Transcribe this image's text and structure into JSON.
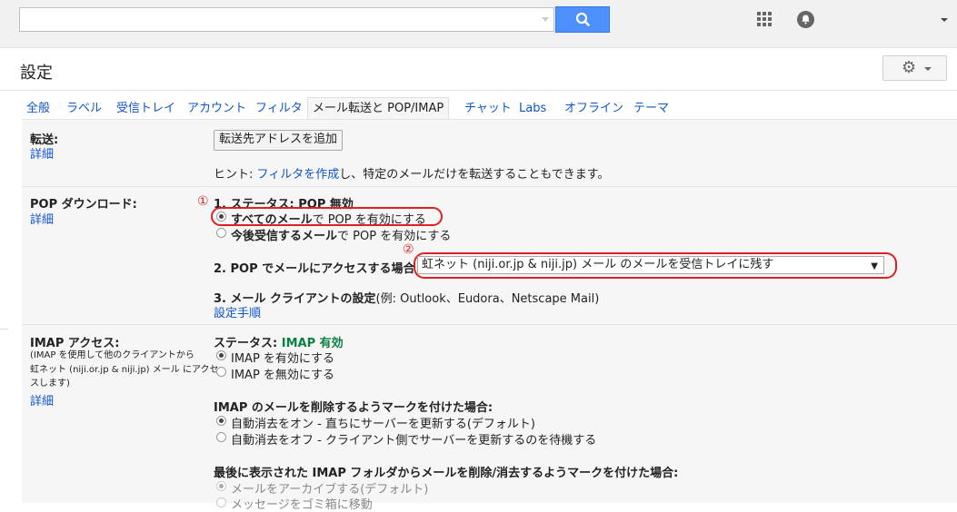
{
  "header": {
    "search_value": "",
    "icons": [
      "search-icon",
      "apps-icon",
      "notifications-icon",
      "chevron-down-icon"
    ]
  },
  "page": {
    "title": "設定",
    "settings_icon": "gear-icon"
  },
  "tabs": [
    {
      "label": "全般"
    },
    {
      "label": "ラベル"
    },
    {
      "label": "受信トレイ"
    },
    {
      "label": "アカウント"
    },
    {
      "label": "フィルタ"
    },
    {
      "label": "メール転送と POP/IMAP",
      "active": true
    },
    {
      "label": "チャット"
    },
    {
      "label": "Labs"
    },
    {
      "label": "オフライン"
    },
    {
      "label": "テーマ"
    }
  ],
  "forwarding": {
    "label": "転送:",
    "details": "詳細",
    "add_button": "転送先アドレスを追加",
    "hint_prefix": "ヒント: ",
    "hint_link": "フィルタを作成",
    "hint_suffix": "し、特定のメールだけを転送することもできます。"
  },
  "pop": {
    "label": "POP ダウンロード:",
    "details": "詳細",
    "marker1": "①",
    "marker2": "②",
    "status_prefix": "1. ステータス: ",
    "status_value": "POP 無効",
    "option_all_bold": "すべてのメール",
    "option_all_rest": "で POP を有効にする",
    "option_future_bold": "今後受信するメール",
    "option_future_rest": "で POP を有効にする",
    "access_label": "2. POP でメールにアクセスする場合",
    "access_select_value": "虹ネット (niji.or.jp & niji.jp) メール のメールを受信トレイに残す",
    "client_label": "3. メール クライアントの設定",
    "client_examples": "(例: Outlook、Eudora、Netscape Mail)",
    "setup_link": "設定手順"
  },
  "imap": {
    "label": "IMAP アクセス:",
    "desc1": "(IMAP を使用して他のクライアントから",
    "desc2": "虹ネット (niji.or.jp & niji.jp) メール にアクセ",
    "desc3": "スします)",
    "details": "詳細",
    "status_prefix": "ステータス: ",
    "status_value": "IMAP 有効",
    "enable": "IMAP を有効にする",
    "disable": "IMAP を無効にする",
    "delete_heading": "IMAP のメールを削除するようマークを付けた場合:",
    "autoexpunge_on": "自動消去をオン - 直ちにサーバーを更新する(デフォルト)",
    "autoexpunge_off": "自動消去をオフ - クライアント側でサーバーを更新するのを待機する",
    "folder_heading": "最後に表示された IMAP フォルダからメールを削除/消去するようマークを付けた場合:",
    "archive": "メールをアーカイブする(デフォルト)",
    "trash": "メッセージをゴミ箱に移動"
  }
}
